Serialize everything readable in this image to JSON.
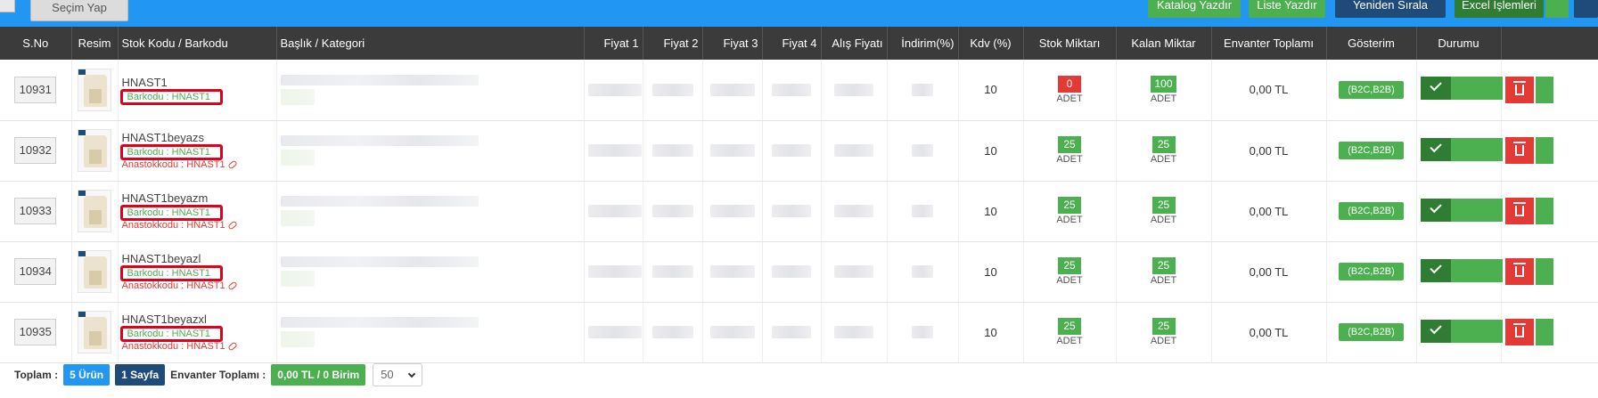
{
  "toolbar": {
    "secim_label": "Seçim Yap",
    "katalog_label": "Katalog Yazdır",
    "liste_label": "Liste Yazdır",
    "yeniden_label": "Yeniden Sırala",
    "excel_label": "Excel İşlemleri"
  },
  "columns": [
    "S.No",
    "Resim",
    "Stok Kodu / Barkodu",
    "Başlık / Kategori",
    "Fiyat 1",
    "Fiyat 2",
    "Fiyat 3",
    "Fiyat 4",
    "Alış Fiyatı",
    "İndirim(%)",
    "Kdv (%)",
    "Stok Miktarı",
    "Kalan Miktar",
    "Envanter Toplamı",
    "Gösterim",
    "Durumu",
    ""
  ],
  "rows": [
    {
      "sno": "10931",
      "code": "HNAST1",
      "barcode": "Barkodu : HNAST1",
      "anastok": "",
      "kdv": "10",
      "stok": "0",
      "stok_unit": "ADET",
      "kalan": "100",
      "kalan_unit": "ADET",
      "envanter": "0,00 TL",
      "gosterim": "(B2C,B2B)"
    },
    {
      "sno": "10932",
      "code": "HNAST1beyazs",
      "barcode": "Barkodu : HNAST1",
      "anastok": "Anastokkodu : HNAST1",
      "kdv": "10",
      "stok": "25",
      "stok_unit": "ADET",
      "kalan": "25",
      "kalan_unit": "ADET",
      "envanter": "0,00 TL",
      "gosterim": "(B2C,B2B)"
    },
    {
      "sno": "10933",
      "code": "HNAST1beyazm",
      "barcode": "Barkodu : HNAST1",
      "anastok": "Anastokkodu : HNAST1",
      "kdv": "10",
      "stok": "25",
      "stok_unit": "ADET",
      "kalan": "25",
      "kalan_unit": "ADET",
      "envanter": "0,00 TL",
      "gosterim": "(B2C,B2B)"
    },
    {
      "sno": "10934",
      "code": "HNAST1beyazl",
      "barcode": "Barkodu : HNAST1",
      "anastok": "Anastokkodu : HNAST1",
      "kdv": "10",
      "stok": "25",
      "stok_unit": "ADET",
      "kalan": "25",
      "kalan_unit": "ADET",
      "envanter": "0,00 TL",
      "gosterim": "(B2C,B2B)"
    },
    {
      "sno": "10935",
      "code": "HNAST1beyazxl",
      "barcode": "Barkodu : HNAST1",
      "anastok": "Anastokkodu : HNAST1",
      "kdv": "10",
      "stok": "25",
      "stok_unit": "ADET",
      "kalan": "25",
      "kalan_unit": "ADET",
      "envanter": "0,00 TL",
      "gosterim": "(B2C,B2B)"
    }
  ],
  "footer": {
    "toplam_label": "Toplam :",
    "urun_count": "5 Ürün",
    "sayfa_count": "1 Sayfa",
    "envanter_label": "Envanter Toplamı :",
    "envanter_value": "0,00 TL / 0 Birim",
    "per_page": "50"
  },
  "colors": {
    "header_bg": "#3b3b3b",
    "toolbar_bg": "#2196f3",
    "green": "#4caf50",
    "red": "#e53935",
    "navy": "#1f4b7a"
  }
}
